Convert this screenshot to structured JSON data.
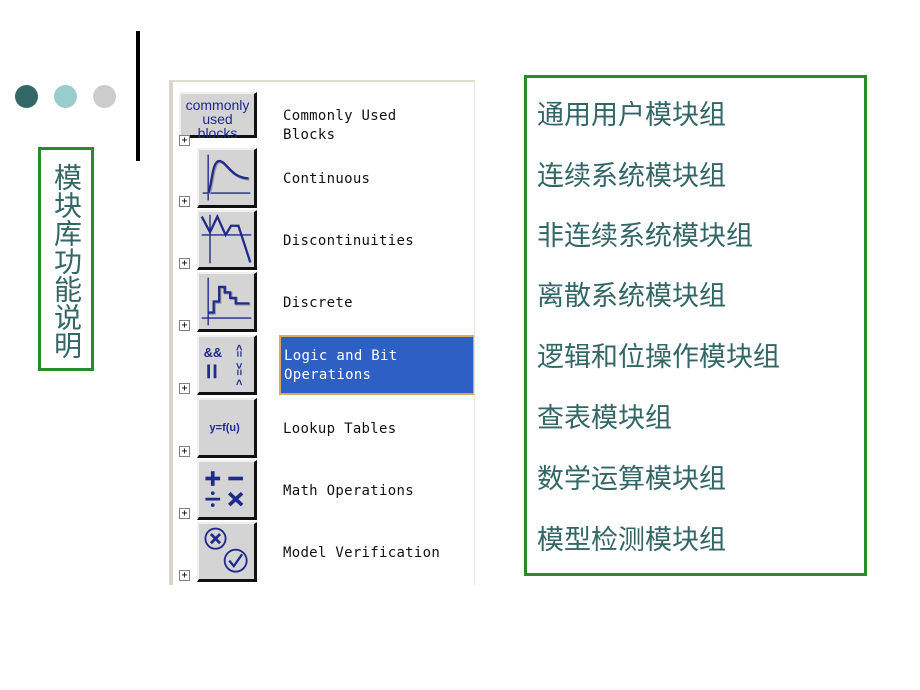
{
  "decor": {
    "dots": [
      "#336666",
      "#99cccc",
      "#cccccc"
    ],
    "accent_green": "#2a8a2a",
    "text_teal": "#336666",
    "selection_blue": "#2e5fc4"
  },
  "title": {
    "text": "模块库功能说明"
  },
  "library_browser": {
    "items": [
      {
        "label": "Commonly Used\nBlocks",
        "icon": "commonly-used-blocks-icon",
        "icon_text_1": "commonly",
        "icon_text_2": "used blocks",
        "expand": "+",
        "selected": false
      },
      {
        "label": "Continuous",
        "icon": "continuous-icon",
        "expand": "+",
        "selected": false
      },
      {
        "label": "Discontinuities",
        "icon": "discontinuities-icon",
        "expand": "+",
        "selected": false
      },
      {
        "label": "Discrete",
        "icon": "discrete-icon",
        "expand": "+",
        "selected": false
      },
      {
        "label": "Logic and Bit\nOperations",
        "icon": "logic-bit-operations-icon",
        "expand": "+",
        "selected": true
      },
      {
        "label": "Lookup Tables",
        "icon": "lookup-tables-icon",
        "icon_text": "y=f(u)",
        "expand": "+",
        "selected": false
      },
      {
        "label": "Math Operations",
        "icon": "math-operations-icon",
        "expand": "+",
        "selected": false
      },
      {
        "label": "Model Verification",
        "icon": "model-verification-icon",
        "expand": "+",
        "selected": false
      }
    ]
  },
  "descriptions": [
    "通用用户模块组",
    "连续系统模块组",
    "非连续系统模块组",
    "离散系统模块组",
    "逻辑和位操作模块组",
    "查表模块组",
    "数学运算模块组",
    "模型检测模块组"
  ]
}
